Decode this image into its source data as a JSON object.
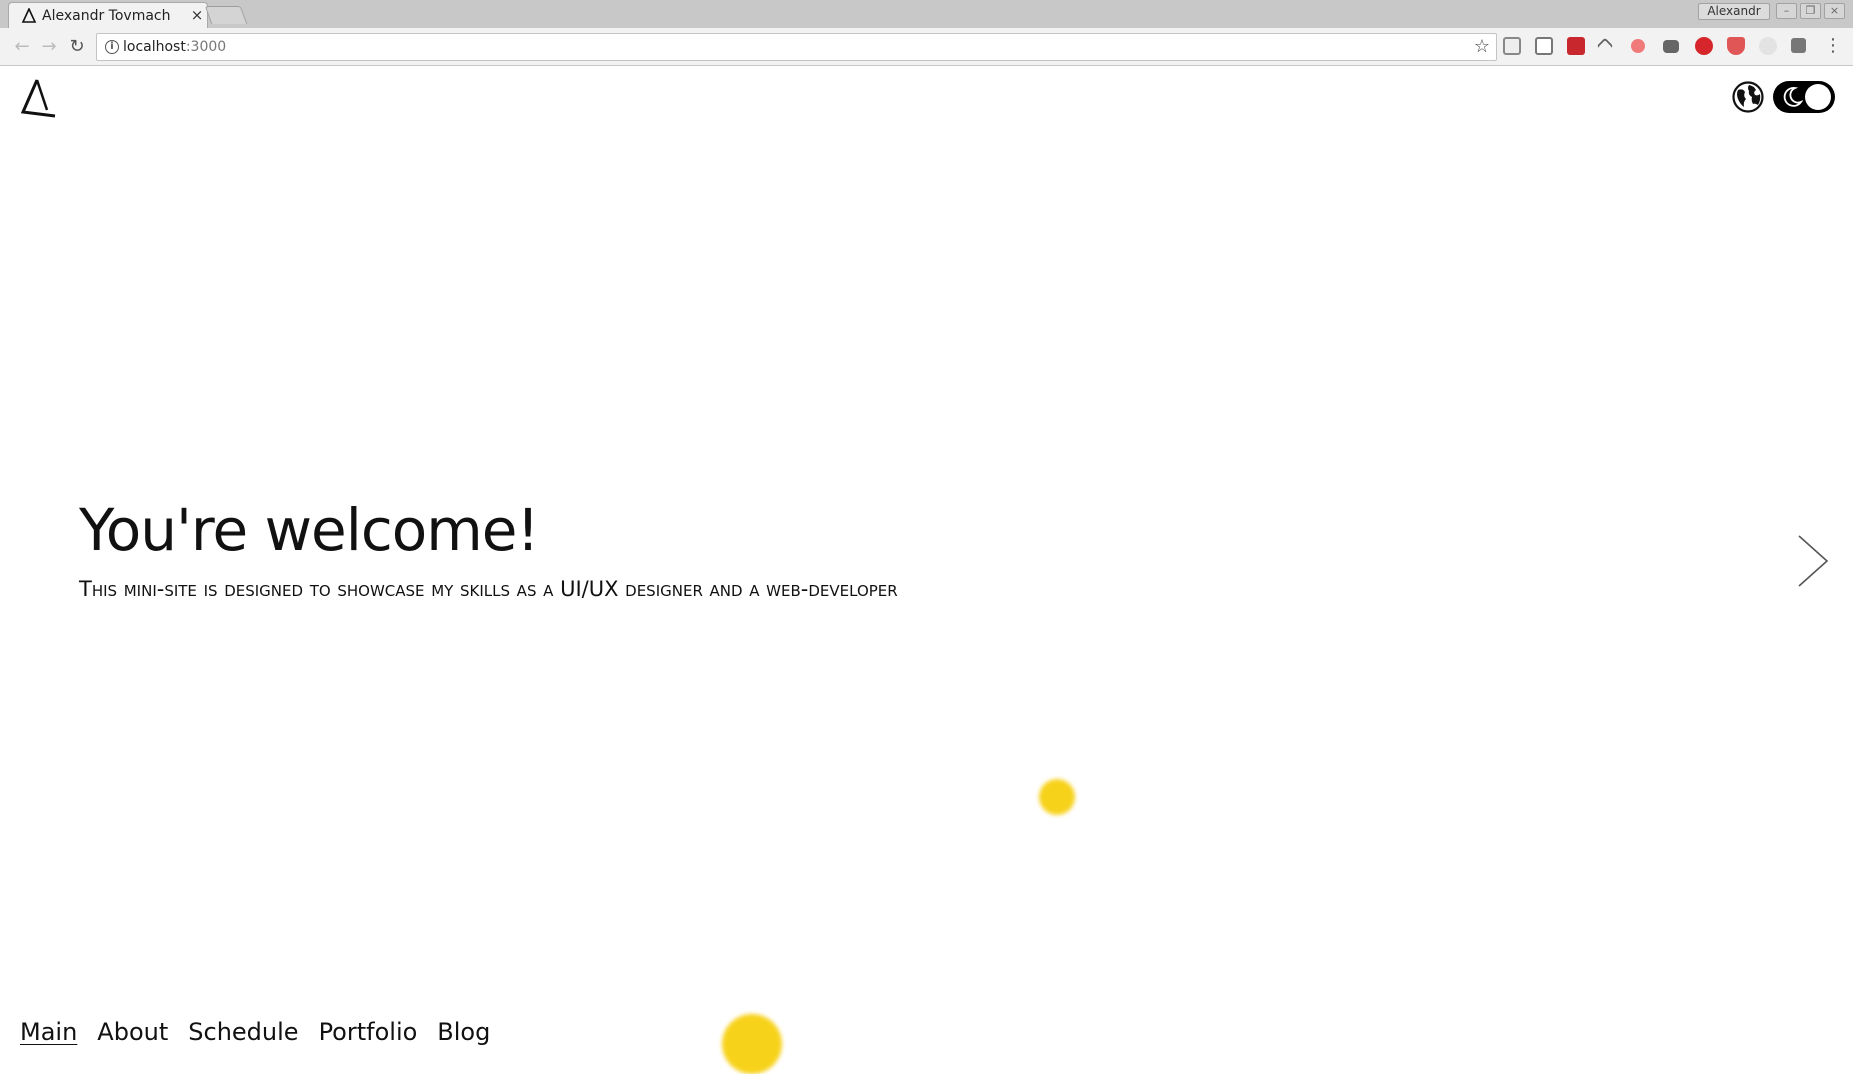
{
  "browser": {
    "tab": {
      "title": "Alexandr Tovmach",
      "close_glyph": "×"
    },
    "profile_name": "Alexandr",
    "url": {
      "host": "localhost",
      "port": ":3000"
    },
    "window_controls": {
      "minimize": "–",
      "restore": "❐",
      "close": "×"
    }
  },
  "header": {
    "logo_icon": "triangle-logo-icon",
    "language_icon": "globe-icon",
    "theme_toggle_icon": "moon-icon"
  },
  "hero": {
    "title": "You're welcome!",
    "subtitle": "This mini-site is designed to showcase my skills as a UI/UX designer and a web-developer"
  },
  "navigation": {
    "items": [
      {
        "label": "Main",
        "active": true
      },
      {
        "label": "About"
      },
      {
        "label": "Schedule"
      },
      {
        "label": "Portfolio"
      },
      {
        "label": "Blog"
      }
    ]
  },
  "colors": {
    "accent_blob": "#f7d21b",
    "text": "#111111",
    "background": "#ffffff"
  }
}
